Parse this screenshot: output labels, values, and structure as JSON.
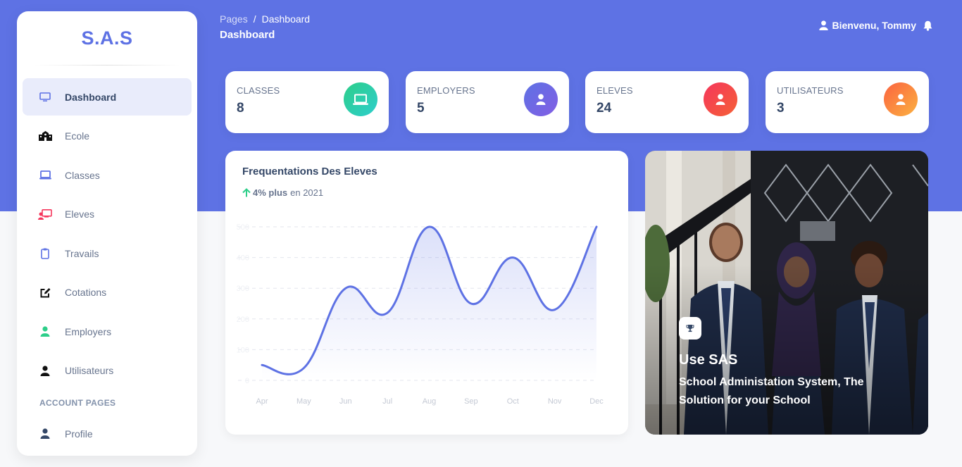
{
  "brand": "S.A.S",
  "header": {
    "breadcrumb_root": "Pages",
    "breadcrumb_separator": "/",
    "breadcrumb_current": "Dashboard",
    "title": "Dashboard",
    "user_greeting": "Bienvenu, Tommy"
  },
  "sidebar": {
    "items": [
      {
        "label": "Dashboard",
        "icon": "monitor-icon",
        "active": true
      },
      {
        "label": "Ecole",
        "icon": "school-icon"
      },
      {
        "label": "Classes",
        "icon": "laptop-icon"
      },
      {
        "label": "Eleves",
        "icon": "students-icon"
      },
      {
        "label": "Travails",
        "icon": "clipboard-icon"
      },
      {
        "label": "Cotations",
        "icon": "edit-icon"
      },
      {
        "label": "Employers",
        "icon": "user-icon"
      },
      {
        "label": "Utilisateurs",
        "icon": "user-icon"
      }
    ],
    "section_title": "ACCOUNT PAGES",
    "account_items": [
      {
        "label": "Profile",
        "icon": "profile-icon"
      }
    ]
  },
  "stats": [
    {
      "label": "CLASSES",
      "value": "8",
      "icon": "laptop-icon",
      "color": "#2dce89"
    },
    {
      "label": "EMPLOYERS",
      "value": "5",
      "icon": "user-icon",
      "color": "#825ee4"
    },
    {
      "label": "ELEVES",
      "value": "24",
      "icon": "user-icon",
      "color": "#f5365c"
    },
    {
      "label": "UTILISATEURS",
      "value": "3",
      "icon": "user-icon",
      "color": "#fb6340"
    }
  ],
  "chart": {
    "title": "Frequentations Des Eleves",
    "delta": "4% plus",
    "delta_suffix": "en 2021"
  },
  "chart_data": {
    "type": "area",
    "title": "Frequentations Des Eleves",
    "categories": [
      "Apr",
      "May",
      "Jun",
      "Jul",
      "Aug",
      "Sep",
      "Oct",
      "Nov",
      "Dec"
    ],
    "series": [
      {
        "values": [
          50,
          40,
          300,
          220,
          500,
          250,
          400,
          230,
          500
        ]
      }
    ],
    "y_ticks": [
      0,
      100,
      200,
      300,
      400,
      500
    ],
    "ylim": [
      0,
      500
    ],
    "grid": true,
    "color": "#5e72e4"
  },
  "promo": {
    "title": "Use SAS",
    "text": "School Administation System, The Solution for your School",
    "icon": "trophy-icon"
  },
  "colors": {
    "primary": "#5e72e4",
    "success": "#2dce89"
  }
}
